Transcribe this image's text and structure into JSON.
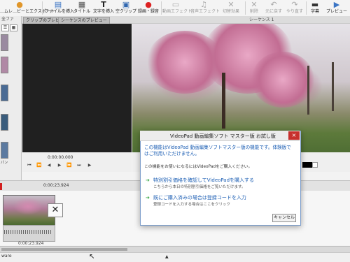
{
  "toolbar": {
    "items": [
      {
        "label": "…ムレ…ビーとエクスポート",
        "icon": "home-icon"
      },
      {
        "label": "ファイルを挿入",
        "icon": "add-file-icon"
      },
      {
        "label": "タイトル",
        "icon": "title-icon"
      },
      {
        "label": "文字を挿入",
        "icon": "text-icon"
      },
      {
        "label": "空クリップ",
        "icon": "blank-clip-icon"
      },
      {
        "label": "録画・録音",
        "icon": "record-icon"
      },
      {
        "label": "動画エフェクト",
        "icon": "video-effects-icon"
      },
      {
        "label": "音声エフェクト",
        "icon": "audio-effects-icon"
      },
      {
        "label": "切替効果",
        "icon": "transition-icon"
      },
      {
        "label": "削除",
        "icon": "delete-icon"
      },
      {
        "label": "元に戻す",
        "icon": "undo-icon"
      },
      {
        "label": "やり直す",
        "icon": "redo-icon"
      },
      {
        "label": "字幕",
        "icon": "subtitle-icon"
      },
      {
        "label": "プレビュー",
        "icon": "preview-icon"
      }
    ]
  },
  "tabs": {
    "clip_preview": "クリップのプレビュー",
    "sequence_preview": "シーケンスのプレビュー",
    "sequence_name": "シーケンス 1"
  },
  "sidebar": {
    "tab": "全ファ",
    "caption": "パン"
  },
  "clip_preview": {
    "time": "0:00:00.000"
  },
  "timeline": {
    "ruler_time": "0:00:23.924",
    "clip_time": "0:00:23.924"
  },
  "statusbar": {
    "text": "ware"
  },
  "dialog": {
    "title": "VideoPad 動画編集ソフト マスター版 お試し版",
    "close": "×",
    "message": "この機能はVideoPad 動画編集ソフトマスター版の機能です。体験版ではご利用いただけません。",
    "note": "この機能をお使いになるにはVideoPadをご購入ください。",
    "option1_title": "特別割引価格を確認してVideoPadを購入する",
    "option1_sub": "こちらから本日の特別割引価格をご覧いただけます。",
    "option2_title": "既にご購入済みの場合は登録コードを入力",
    "option2_sub": "登録コードを入力する場合はここをクリック",
    "cancel": "キャンセル"
  },
  "colors": {
    "accent_blue": "#1d5fb4",
    "option_arrow_green": "#2ea33a",
    "close_red": "#c7302d",
    "playhead_red": "#d21f1f"
  }
}
